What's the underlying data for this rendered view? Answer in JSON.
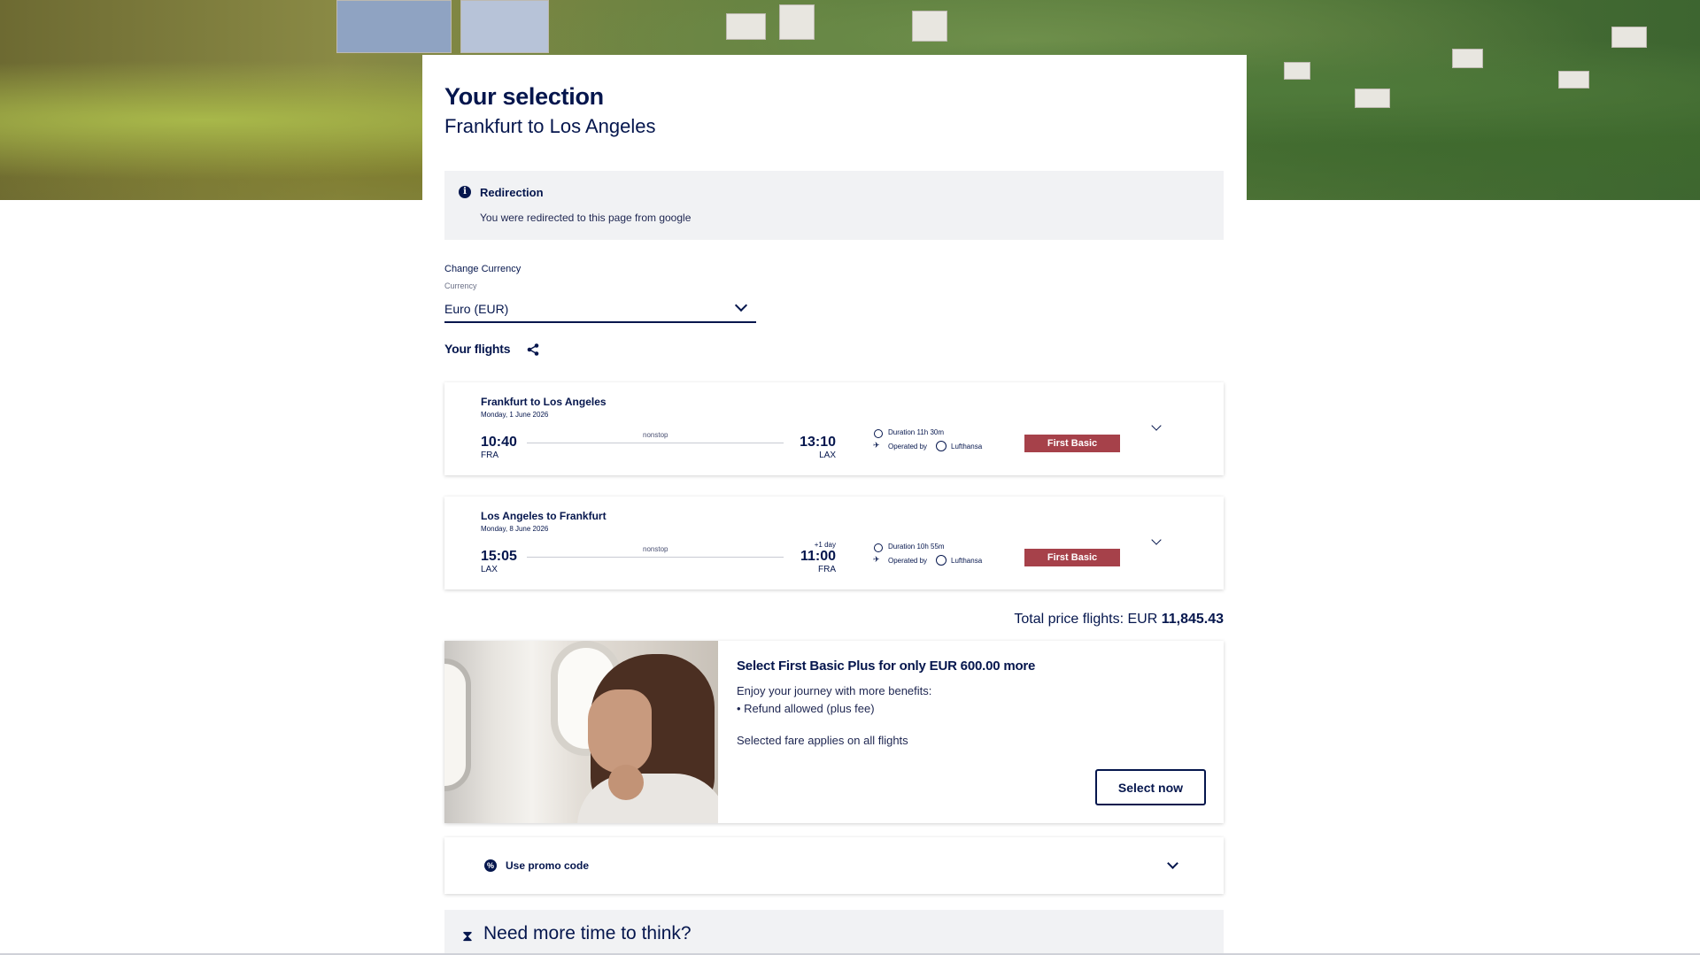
{
  "header": {
    "title": "Your selection",
    "subtitle": "Frankfurt to Los Angeles"
  },
  "notice": {
    "icon": "info-icon",
    "title": "Redirection",
    "text": "You were redirected to this page from google"
  },
  "currency": {
    "label": "Change Currency",
    "field_label": "Currency",
    "selected": "Euro (EUR)"
  },
  "flights_section": {
    "heading": "Your flights",
    "share_icon": "share-icon"
  },
  "flights": [
    {
      "route": "Frankfurt to Los Angeles",
      "date": "Monday, 1 June 2026",
      "dep_time": "10:40",
      "dep_code": "FRA",
      "stops": "nonstop",
      "next_day": "",
      "arr_time": "13:10",
      "arr_code": "LAX",
      "duration": "Duration 11h 30m",
      "operated_label": "Operated by",
      "carrier": "Lufthansa",
      "fare": "First Basic"
    },
    {
      "route": "Los Angeles to Frankfurt",
      "date": "Monday, 8 June 2026",
      "dep_time": "15:05",
      "dep_code": "LAX",
      "stops": "nonstop",
      "next_day": "+1 day",
      "arr_time": "11:00",
      "arr_code": "FRA",
      "duration": "Duration 10h 55m",
      "operated_label": "Operated by",
      "carrier": "Lufthansa",
      "fare": "First Basic"
    }
  ],
  "total": {
    "label": "Total price flights:",
    "currency": "EUR",
    "amount": "11,845.43"
  },
  "upsell": {
    "title": "Select First Basic Plus for only EUR 600.00 more",
    "line1": "Enjoy your journey with more benefits:",
    "line2": "• Refund allowed (plus fee)",
    "line3": "Selected fare applies on all flights",
    "button": "Select now"
  },
  "promo": {
    "label": "Use promo code"
  },
  "think": {
    "label": "Need more time to think?"
  },
  "colors": {
    "brand_navy": "#05164d",
    "fare_badge": "#a6414a",
    "notice_bg": "#f1f2f4"
  }
}
